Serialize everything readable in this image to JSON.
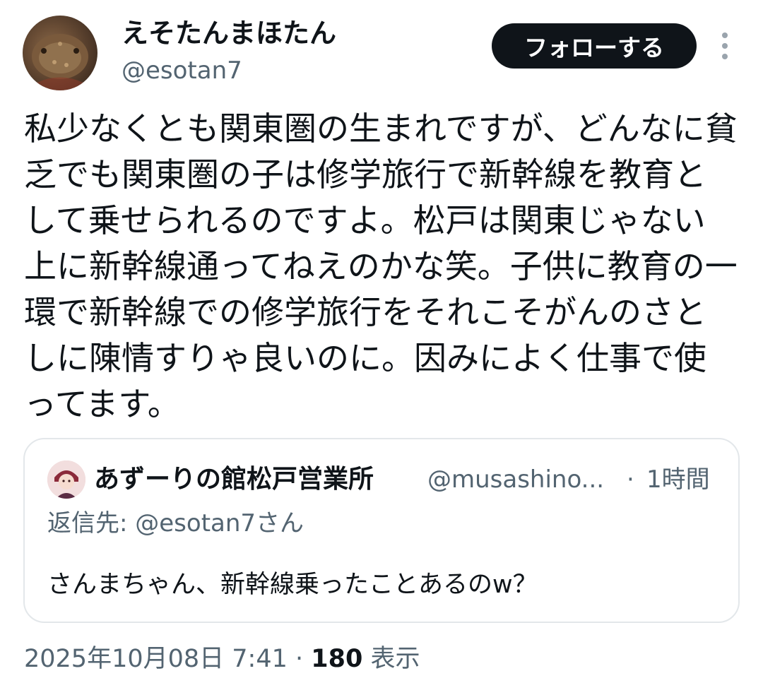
{
  "author": {
    "display_name": "えそたんまほたん",
    "handle": "@esotan7"
  },
  "follow_button": {
    "label": "フォローする"
  },
  "more_icon": "vertical-dots-icon",
  "post": {
    "text": "私少なくとも関東圏の生まれですが、どんなに貧乏でも関東圏の子は修学旅行で新幹線を教育として乗せられるのですよ。松戸は関東じゃない上に新幹線通ってねえのかな笑。子供に教育の一環で新幹線での修学旅行をそれこそがんのさとしに陳情すりゃ良いのに。因みによく仕事で使ってます。"
  },
  "quote": {
    "display_name": "あずーりの館松戸営業所",
    "handle": "@musashino...",
    "separator": "·",
    "time": "1時間",
    "reply_to": "返信先: @esotan7さん",
    "text": "さんまちゃん、新幹線乗ったことあるのw？"
  },
  "meta": {
    "timestamp": "2025年10月08日 7:41",
    "separator": " · ",
    "views_count": "180",
    "views_label": " 表示"
  },
  "colors": {
    "text_primary": "#0f1419",
    "text_secondary": "#536471",
    "button_bg": "#0f1419",
    "border": "#e3e7ea"
  }
}
